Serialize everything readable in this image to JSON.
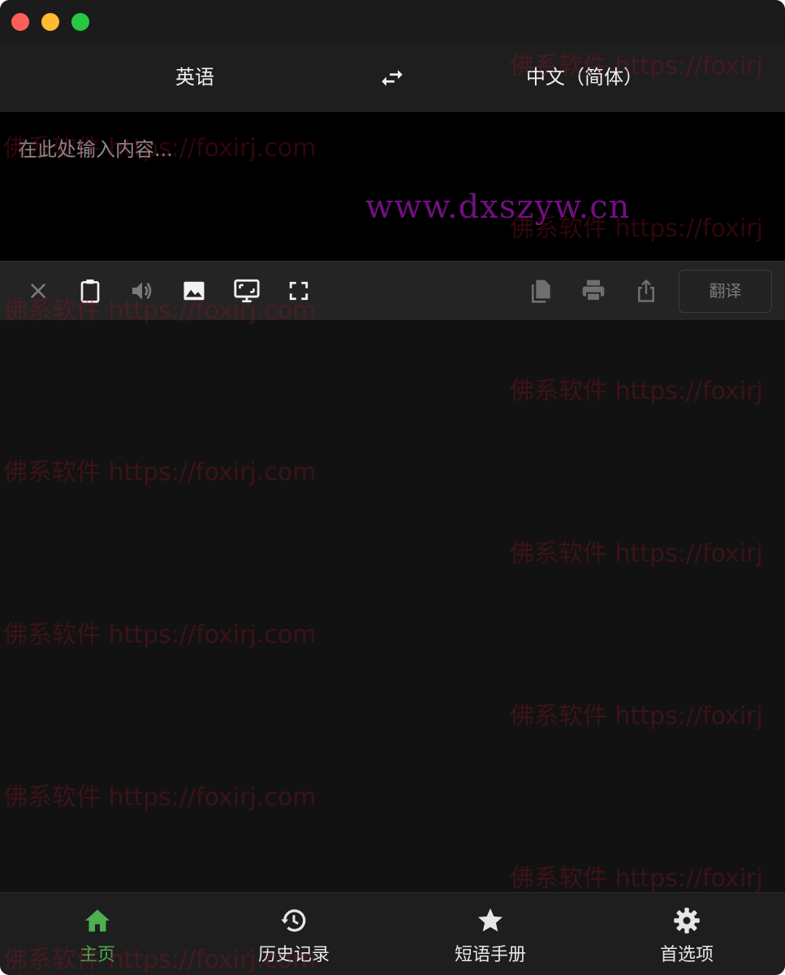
{
  "language_bar": {
    "source_language": "英语",
    "target_language": "中文（简体）"
  },
  "input": {
    "placeholder": "在此处输入内容...",
    "value": ""
  },
  "toolbar": {
    "translate_label": "翻译",
    "icons": [
      "close-icon",
      "clipboard-icon",
      "speaker-icon",
      "image-icon",
      "screen-capture-icon",
      "fullscreen-icon",
      "copy-icon",
      "print-icon",
      "share-icon"
    ]
  },
  "tabs": [
    {
      "label": "主页",
      "icon": "home-icon",
      "active": true
    },
    {
      "label": "历史记录",
      "icon": "history-icon",
      "active": false
    },
    {
      "label": "短语手册",
      "icon": "star-icon",
      "active": false
    },
    {
      "label": "首选项",
      "icon": "gear-icon",
      "active": false
    }
  ],
  "colors": {
    "accent": "#4caf50",
    "background": "#121212",
    "toolbar": "#242424",
    "input_background": "#000000"
  },
  "watermarks": {
    "primary": "佛系软件 https://foxirj.com",
    "primary_clipped": "佛系软件 https://foxirj",
    "secondary": "www.dxszyw.cn"
  }
}
